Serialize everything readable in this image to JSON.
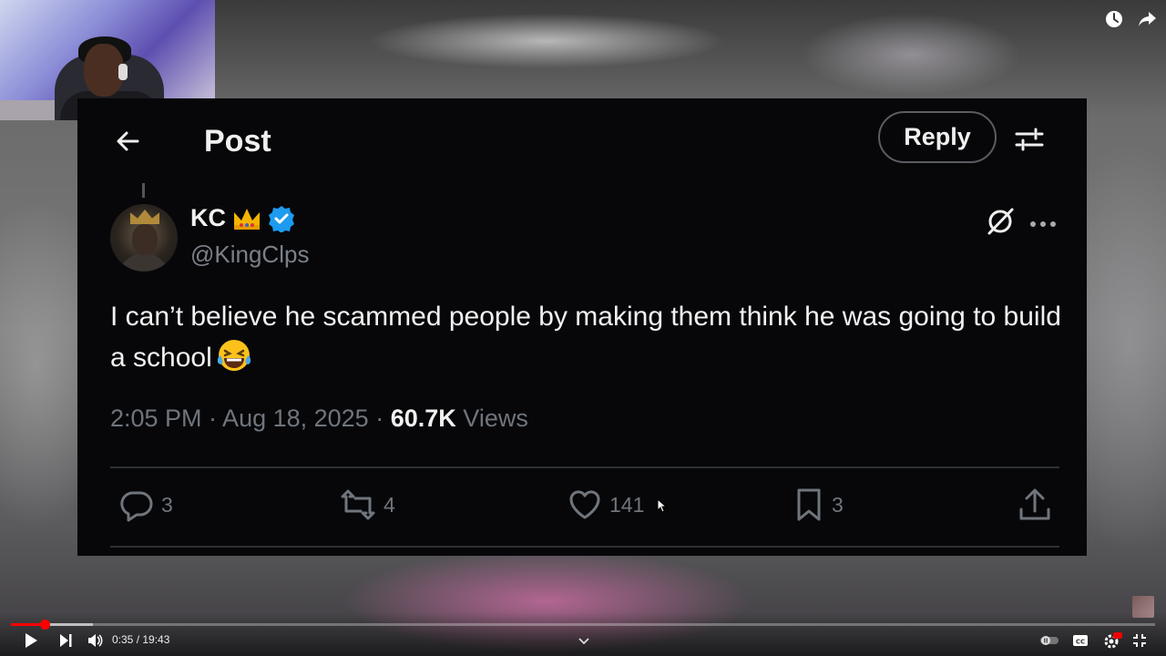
{
  "post": {
    "title": "Post",
    "reply_label": "Reply",
    "author": {
      "name": "KC",
      "handle": "@KingClps"
    },
    "text": "I can’t believe he scammed people by making them think he was going to build a school",
    "timestamp": "2:05 PM · Aug 18, 2025 ·",
    "views_count": "60.7K",
    "views_label": "Views",
    "stats": {
      "replies": "3",
      "reposts": "4",
      "likes": "141",
      "bookmarks": "3"
    }
  },
  "player": {
    "time": "0:35 / 19:43",
    "progress_fraction": 0.0296,
    "buffer_fraction": 0.072,
    "accent_color": "#ff0000"
  },
  "icons": [
    "watch-later-icon",
    "share-icon",
    "back-arrow-icon",
    "filter-icon",
    "verified-icon",
    "grok-icon",
    "more-icon",
    "reply-icon",
    "repost-icon",
    "like-icon",
    "bookmark-icon",
    "share-post-icon",
    "play-icon",
    "next-icon",
    "volume-icon",
    "autoplay-toggle-icon",
    "captions-icon",
    "settings-icon",
    "exit-fullscreen-icon"
  ]
}
